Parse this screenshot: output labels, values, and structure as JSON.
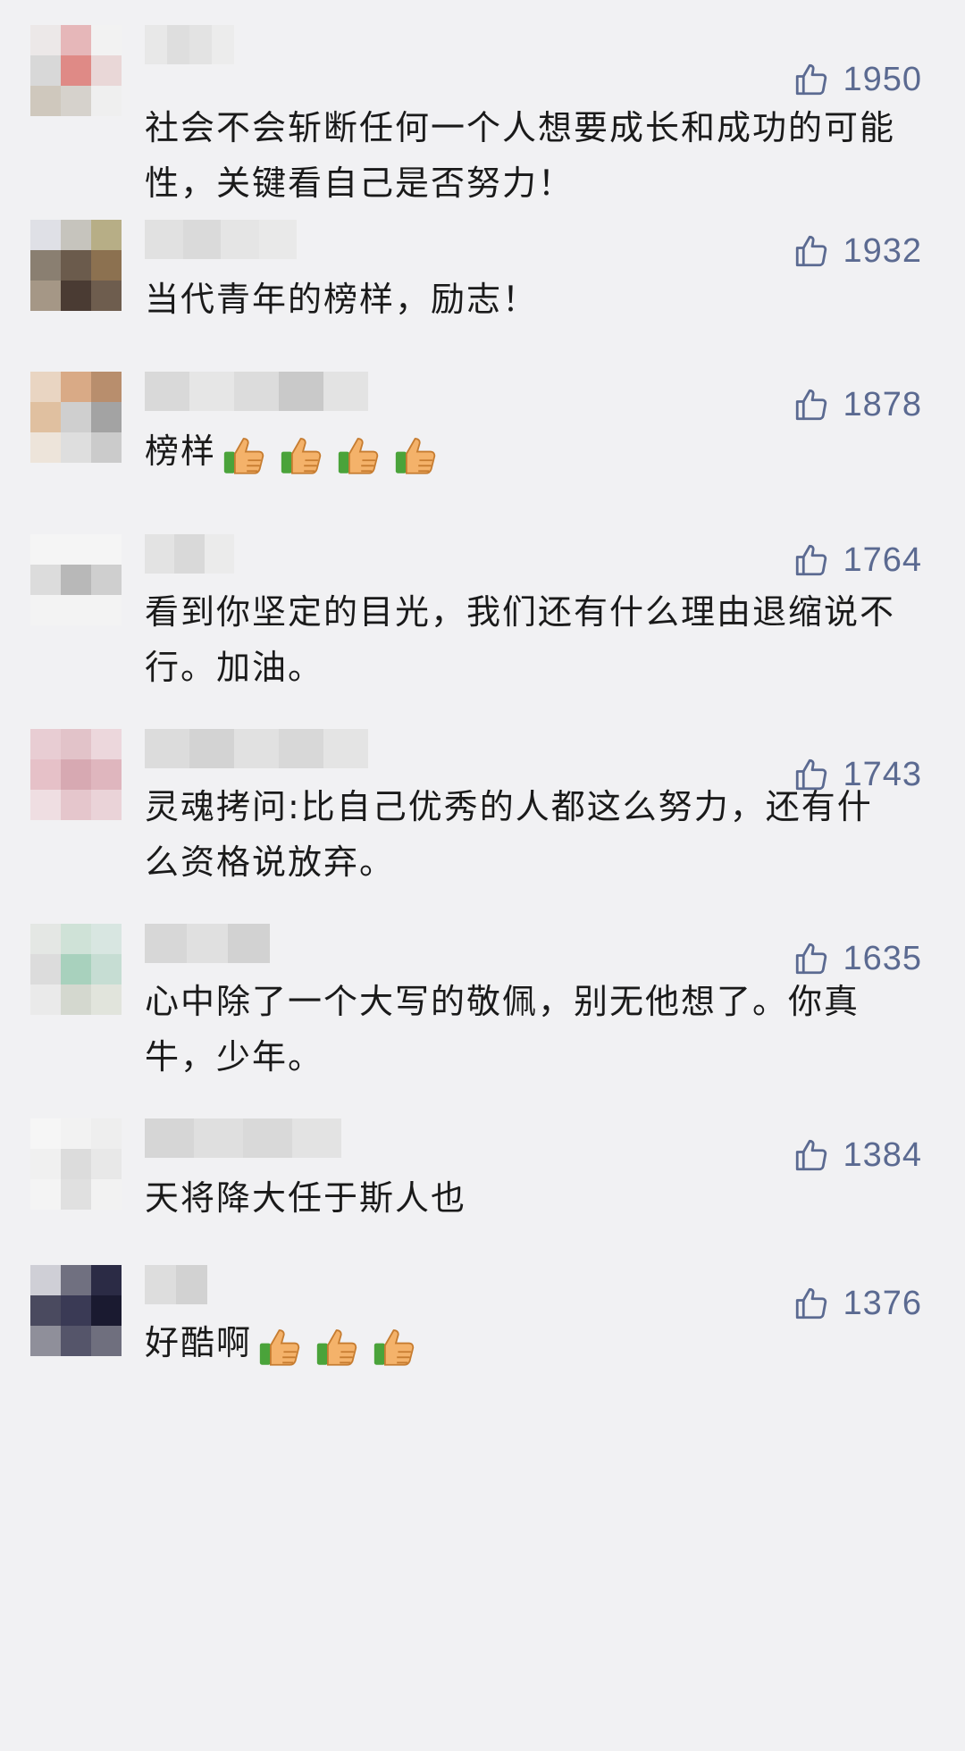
{
  "comments": [
    {
      "likes": "1950",
      "text": "社会不会斩断任何一个人想要成长和成功的可能性，关键看自己是否努力！",
      "emoji_count": 0,
      "avatar_colors": [
        "#ece8e8",
        "#e6b7b9",
        "#f2f2f2",
        "#d8d8d8",
        "#df8a86",
        "#e9d7d7",
        "#cfc8bd",
        "#d6d2cc",
        "#efefef"
      ],
      "nick_colors": [
        "#e8e8e8",
        "#dedede",
        "#e3e3e3",
        "#ececec"
      ]
    },
    {
      "likes": "1932",
      "text": "当代青年的榜样，励志！",
      "emoji_count": 0,
      "avatar_colors": [
        "#dfe0e6",
        "#c6c4bd",
        "#b7ae86",
        "#8a7f71",
        "#6b5b4c",
        "#8c7150",
        "#a59786",
        "#4a3b33",
        "#6e5d4e"
      ],
      "nick_colors": [
        "#e1e1e1",
        "#dadada",
        "#e5e5e5",
        "#e9e9e9"
      ]
    },
    {
      "likes": "1878",
      "text": "榜样",
      "emoji_count": 4,
      "avatar_colors": [
        "#e9d5c2",
        "#d9aa86",
        "#b88e6d",
        "#e0c0a0",
        "#cfcfcf",
        "#a3a3a3",
        "#ede4da",
        "#dedede",
        "#cbcbcb"
      ],
      "nick_colors": [
        "#d9d9d9",
        "#e6e6e6",
        "#dcdcdc",
        "#c9c9c9",
        "#e3e3e3"
      ]
    },
    {
      "likes": "1764",
      "text": "看到你坚定的目光，我们还有什么理由退缩说不行。加油。",
      "emoji_count": 0,
      "avatar_colors": [
        "#f5f5f5",
        "#f5f5f5",
        "#f5f5f5",
        "#dcdcdc",
        "#b8b8b8",
        "#cfcfcf",
        "#f3f3f3",
        "#f3f3f3",
        "#f3f3f3"
      ],
      "nick_colors": [
        "#e3e3e3",
        "#d9d9d9",
        "#ebebeb"
      ]
    },
    {
      "likes": "1743",
      "text": "灵魂拷问:比自己优秀的人都这么努力，还有什么资格说放弃。",
      "emoji_count": 0,
      "avatar_colors": [
        "#e8cdd3",
        "#e2c3c9",
        "#ecd7dc",
        "#e6c1c8",
        "#d7a9b2",
        "#dfb6be",
        "#efdee2",
        "#e5c6cc",
        "#ead3d8"
      ],
      "nick_colors": [
        "#dcdcdc",
        "#d3d3d3",
        "#e1e1e1",
        "#d8d8d8",
        "#e4e4e4"
      ]
    },
    {
      "likes": "1635",
      "text": "心中除了一个大写的敬佩，别无他想了。你真牛，少年。",
      "emoji_count": 0,
      "avatar_colors": [
        "#e4e7e4",
        "#cfe2d7",
        "#d8e6e1",
        "#dcdcdc",
        "#a8d1bd",
        "#c6ddd3",
        "#eaeaea",
        "#d4d8cf",
        "#e1e4dc"
      ],
      "nick_colors": [
        "#d7d7d7",
        "#e0e0e0",
        "#d2d2d2"
      ]
    },
    {
      "likes": "1384",
      "text": "天将降大任于斯人也",
      "emoji_count": 0,
      "avatar_colors": [
        "#f6f6f6",
        "#f2f2f2",
        "#eeeeee",
        "#f0f0f0",
        "#dcdcdc",
        "#e8e8e8",
        "#f4f4f4",
        "#e0e0e0",
        "#f2f2f2"
      ],
      "nick_colors": [
        "#d6d6d6",
        "#dfdfdf",
        "#d9d9d9",
        "#e3e3e3"
      ]
    },
    {
      "likes": "1376",
      "text": "好酷啊",
      "emoji_count": 3,
      "avatar_colors": [
        "#cfcfd6",
        "#707080",
        "#2b2b45",
        "#4a4a5f",
        "#3a3a55",
        "#1a1a30",
        "#8f8f9a",
        "#55556a",
        "#6f6f7e"
      ],
      "nick_colors": [
        "#dddddd",
        "#d2d2d2"
      ]
    }
  ]
}
